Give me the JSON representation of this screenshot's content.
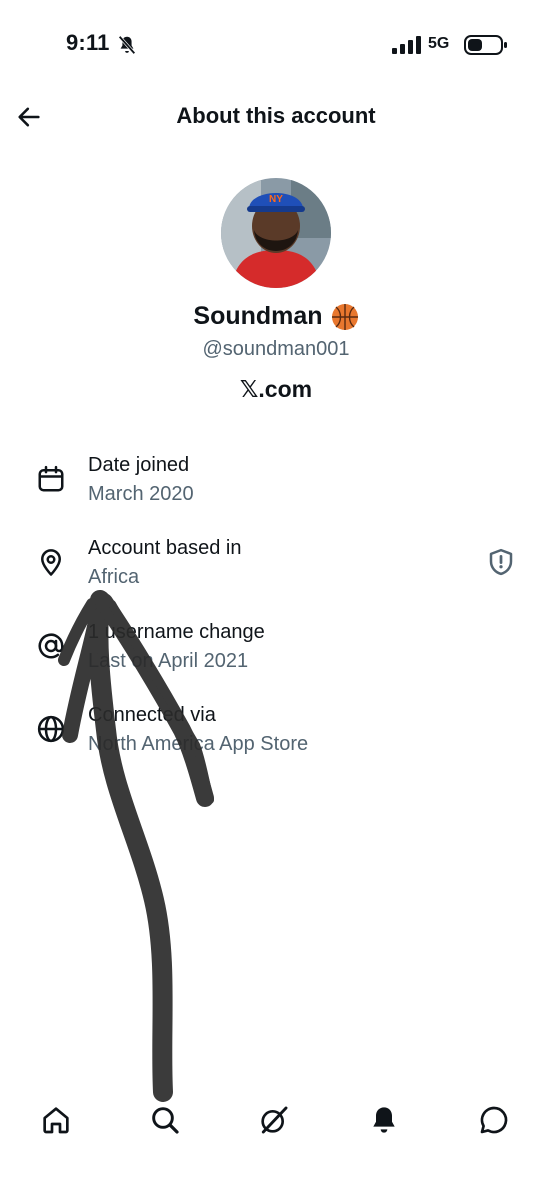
{
  "status_bar": {
    "time": "9:11",
    "network": "5G",
    "icons": [
      "mute-bell-icon",
      "signal-bars-icon",
      "battery-icon"
    ]
  },
  "header": {
    "title": "About this account",
    "back_icon": "arrow-left-icon"
  },
  "profile": {
    "display_name": "Soundman",
    "name_emoji_icon": "basketball-icon",
    "handle": "@soundman001",
    "source_label": "𝕏.com"
  },
  "info": [
    {
      "icon": "calendar-icon",
      "label": "Date joined",
      "value": "March 2020"
    },
    {
      "icon": "location-pin-icon",
      "label": "Account based in",
      "value": "Africa",
      "trailing_icon": "shield-icon"
    },
    {
      "icon": "at-sign-icon",
      "label": "1 username change",
      "value": "Last on April 2021"
    },
    {
      "icon": "globe-icon",
      "label": "Connected via",
      "value": "North America App Store"
    }
  ],
  "bottom_nav": [
    "home-icon",
    "search-icon",
    "grok-icon",
    "notifications-bell-icon",
    "messages-icon"
  ],
  "colors": {
    "text_primary": "#0f1419",
    "text_secondary": "#536471",
    "scribble": "#2a2a2a",
    "background": "#ffffff"
  }
}
